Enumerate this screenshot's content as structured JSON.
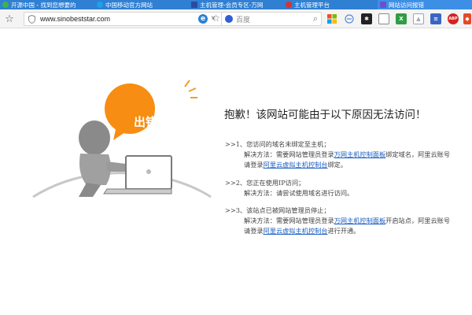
{
  "tabs": [
    {
      "label": "开源中国 - 找到您想要的",
      "icon_color": "#3fb24a",
      "active": false
    },
    {
      "label": "中国移动官方网站",
      "icon_color": "#1aa3e8",
      "active": false
    },
    {
      "label": "主机管理-会员专区-万网",
      "icon_color": "#2a4aa0",
      "active": false
    },
    {
      "label": "主机管理平台",
      "icon_color": "#d9322d",
      "active": false
    },
    {
      "label": "网站访问报错",
      "icon_color": "#6b4fd0",
      "active": true
    }
  ],
  "toolbar": {
    "url": "www.sinobeststar.com",
    "search_placeholder": "百度",
    "ie_label": "e"
  },
  "extensions": [
    {
      "name": "windows-icon",
      "color": "#f25022",
      "text": ""
    },
    {
      "name": "minus-circle-icon",
      "color": "#5a8bd6",
      "text": "−"
    },
    {
      "name": "sun-icon",
      "color": "#222222",
      "text": "✱"
    },
    {
      "name": "square-icon",
      "color": "#8a8a8a",
      "text": ""
    },
    {
      "name": "x-icon",
      "color": "#2f9e44",
      "text": "X"
    },
    {
      "name": "photo-icon",
      "color": "#9aa5b5",
      "text": "▲"
    },
    {
      "name": "document-icon",
      "color": "#3a66c4",
      "text": "≡"
    },
    {
      "name": "abp-icon",
      "color": "#d42323",
      "text": "ABP"
    },
    {
      "name": "extension-icon",
      "color": "#e34a2b",
      "text": "◆"
    }
  ],
  "illustration": {
    "bubble_text": "出错啦！",
    "bubble_color": "#f78d12"
  },
  "error": {
    "title": "抱歉！该网站可能由于以下原因无法访问！",
    "reasons": [
      {
        "heading": ">>1、您访问的域名未绑定至主机；",
        "line1_pre": "解决方法：需要网站管理员登录",
        "line1_link": "万网主机控制面板",
        "line1_post": "绑定域名，阿里云账号",
        "line2_pre": "请登录",
        "line2_link": "阿里云虚拟主机控制台",
        "line2_post": "绑定。"
      },
      {
        "heading": ">>2、您正在使用IP访问；",
        "line1_pre": "解决方法：请尝试使用域名进行访问。"
      },
      {
        "heading": ">>3、该站点已被网站管理员停止；",
        "line1_pre": "解决方法：需要网站管理员登录",
        "line1_link": "万网主机控制面板",
        "line1_post": "开启站点，阿里云账号",
        "line2_pre": "请登录",
        "line2_link": "阿里云虚拟主机控制台",
        "line2_post": "进行开通。"
      }
    ]
  }
}
